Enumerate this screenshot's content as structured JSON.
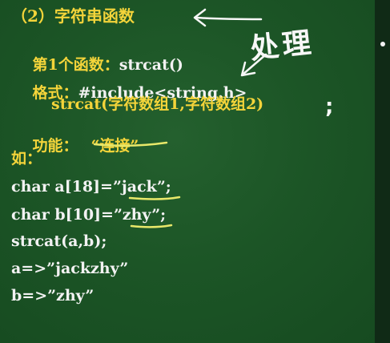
{
  "slide": {
    "section_title": "（2）字符串函数",
    "func_label": "第1个函数：",
    "func_name": "strcat()",
    "format_label": "格式：",
    "format_include": "#include<string.h>",
    "format_call": "strcat(字符数组1,字符数组2)",
    "function_label": "功能：",
    "function_value": "“连接”",
    "example_label": "如：",
    "code_lines": [
      "char a[18]=”jack”;",
      "char b[10]=”zhy”;",
      "strcat(a,b);",
      "a=>”jackzhy”",
      "b=>”zhy”"
    ]
  },
  "annotations": {
    "handwritten_word": "处理",
    "semicolon": ";"
  },
  "colors": {
    "board": "#1c5526",
    "heading_yellow": "#f4d43a",
    "code_white": "#f2f2f2",
    "ink_yellow": "#e8e86a"
  }
}
